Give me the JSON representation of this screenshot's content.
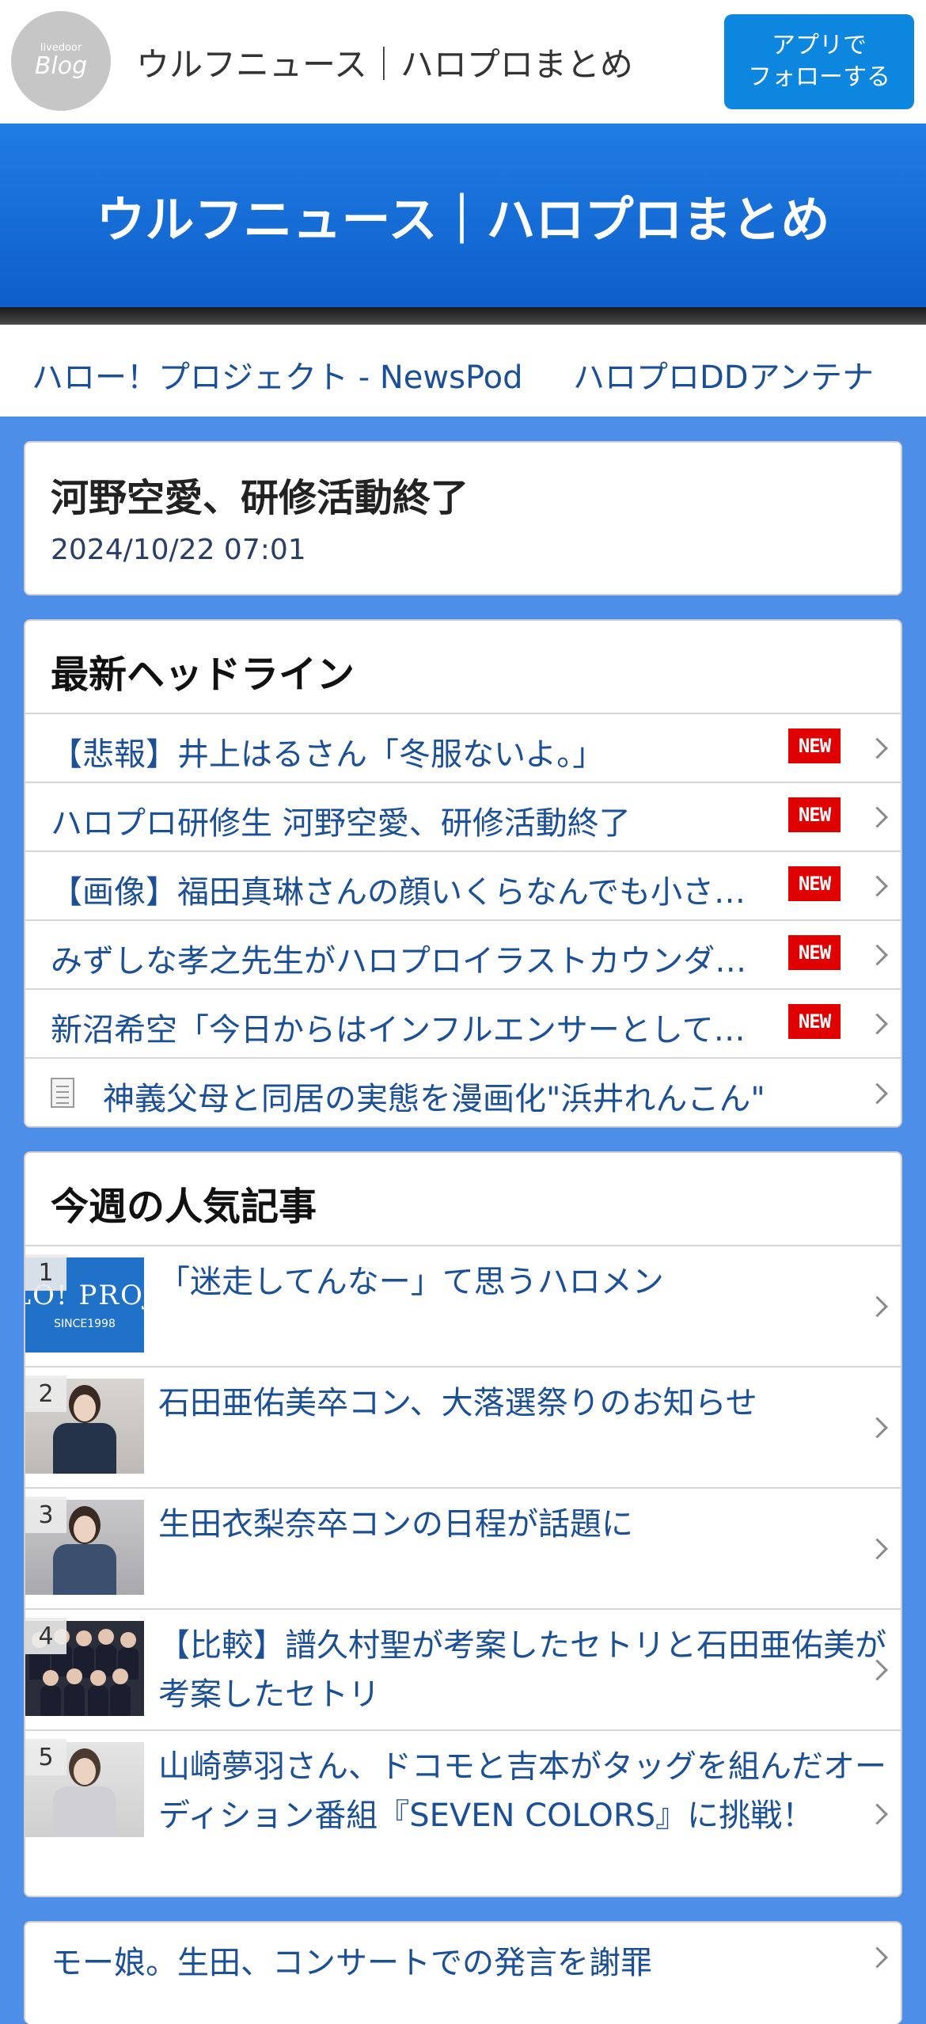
{
  "topbar": {
    "logo_small": "livedoor",
    "logo_big": "Blog",
    "title": "ウルフニュース｜ハロプロまとめ",
    "follow_line1": "アプリで",
    "follow_line2": "フォローする"
  },
  "banner": {
    "title": "ウルフニュース｜ハロプロまとめ"
  },
  "linknav": {
    "link1": "ハロー！プロジェクト - NewsPod",
    "link2": "ハロプロDDアンテナ"
  },
  "article": {
    "title": "河野空愛、研修活動終了",
    "date": "2024/10/22 07:01"
  },
  "headlines": {
    "title": "最新ヘッドライン",
    "new_label": "NEW",
    "items": [
      "【悲報】井上はるさん「冬服ないよ。」",
      "ハロプロ研修生 河野空愛、研修活動終了",
      "【画像】福田真琳さんの顔いくらなんでも小さ…",
      "みずしな孝之先生がハロプロイラストカウンダ…",
      "新沼希空「今日からはインフルエンサーとして…",
      "神義父母と同居の実態を漫画化\"浜井れんこん\""
    ]
  },
  "ranking": {
    "title": "今週の人気記事",
    "thumb1_text": "LO! PROJ",
    "thumb1_sub": "SINCE1998",
    "items": [
      {
        "rank": "1",
        "text": "「迷走してんなー」て思うハロメン"
      },
      {
        "rank": "2",
        "text": "石田亜佑美卒コン、大落選祭りのお知らせ"
      },
      {
        "rank": "3",
        "text": "生田衣梨奈卒コンの日程が話題に"
      },
      {
        "rank": "4",
        "text": "【比較】譜久村聖が考案したセトリと石田亜佑美が考案したセトリ"
      },
      {
        "rank": "5",
        "text": "山崎夢羽さん、ドコモと吉本がタッグを組んだオーディション番組『SEVEN COLORS』に挑戦！"
      }
    ]
  },
  "bottom": {
    "item1": "モー娘。生田、コンサートでの発言を謝罪"
  }
}
